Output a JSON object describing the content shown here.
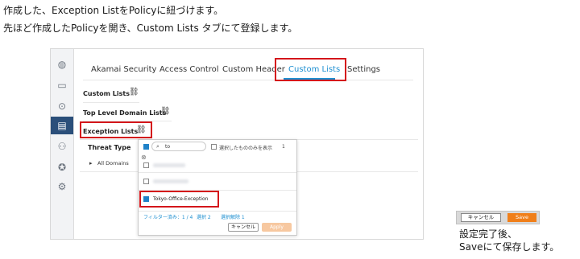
{
  "instructions": {
    "line1": "作成した、Exception ListをPolicyに紐づけます。",
    "line2": "先ほど作成したPolicyを開き、Custom  Lists タブにて登録します。"
  },
  "tabs": [
    "Akamai Security",
    "Access Control",
    "Custom Header",
    "Custom Lists",
    "Settings"
  ],
  "active_tab": "Custom Lists",
  "sections": {
    "custom_lists": "Custom Lists",
    "top_level_domain_lists": "Top Level Domain Lists",
    "exception_lists": "Exception Lists"
  },
  "table": {
    "header": "Threat Type",
    "row": "All Domains"
  },
  "dropdown": {
    "search_value": "to",
    "show_selected_label": "選択したもののみを表示",
    "show_selected_count": "1",
    "selected_item": "Tokyo-Office-Exception",
    "filter_summary": "フィルター済み：1 / 4",
    "select_all": "選択 2",
    "clear_selection": "選択解除 1",
    "cancel_label": "キャンセル",
    "apply_label": "Apply"
  },
  "final_buttons": {
    "cancel": "キャンセル",
    "save": "Save"
  },
  "caption": {
    "line1": "設定完了後、",
    "line2": "Saveにて保存します。"
  },
  "icons": {
    "sidebar": [
      "globe-icon",
      "monitor-icon",
      "location-icon",
      "policy-icon",
      "users-icon",
      "award-icon",
      "settings-icon"
    ]
  },
  "colors": {
    "accent": "#1d8fd1",
    "highlight": "#d4161b",
    "save": "#f07f1a",
    "sidebar_active": "#2b4f7a"
  }
}
